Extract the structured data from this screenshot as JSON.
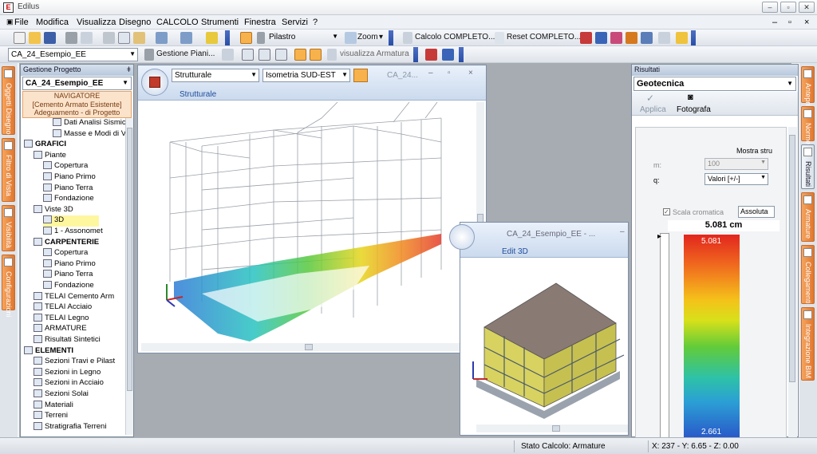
{
  "window": {
    "title": "Edilus",
    "min": "–",
    "max": "▫",
    "close": "✕"
  },
  "menu": [
    "File",
    "Modifica",
    "Visualizza",
    "Disegno",
    "CALCOLO",
    "Strumenti",
    "Finestra",
    "Servizi",
    "?"
  ],
  "toolbar1": {
    "element_combo": "Pilastro",
    "zoom_label": "Zoom",
    "calc_complete": "Calcolo COMPLETO...",
    "reset_complete": "Reset COMPLETO..."
  },
  "toolbar2": {
    "project_combo": "CA_24_Esempio_EE",
    "plans_label": "Gestione Piani...",
    "show_rebar": "visualizza Armatura"
  },
  "left_tabs": [
    "Oggetti Disegno",
    "Filtro di Vista",
    "Visibilità",
    "Configurazioni"
  ],
  "right_tabs": [
    "Anteprima",
    "Norme",
    "Risultati",
    "Armature",
    "Collegamenti",
    "Integrazione BIM"
  ],
  "project_panel": {
    "header": "Gestione Progetto",
    "pin": "ǂ",
    "combo": "CA_24_Esempio_EE",
    "navigator_title": "NAVIGATORE",
    "navigator_line1": "[Cemento Armato Esistente]",
    "navigator_line2": "Adeguamento - di Progetto",
    "tree": [
      {
        "label": "Dati Analisi Sismica",
        "indent": 4
      },
      {
        "label": "Masse e Modi di Vibr",
        "indent": 4
      },
      {
        "label": "GRAFICI",
        "indent": 1
      },
      {
        "label": "Piante",
        "indent": 2
      },
      {
        "label": "Copertura",
        "indent": 3
      },
      {
        "label": "Piano Primo",
        "indent": 3
      },
      {
        "label": "Piano Terra",
        "indent": 3
      },
      {
        "label": "Fondazione",
        "indent": 3
      },
      {
        "label": "Viste 3D",
        "indent": 2
      },
      {
        "label": "3D",
        "indent": 3
      },
      {
        "label": "1 - Assonomet",
        "indent": 3
      },
      {
        "label": "CARPENTERIE",
        "indent": 2
      },
      {
        "label": "Copertura",
        "indent": 3
      },
      {
        "label": "Piano Primo",
        "indent": 3
      },
      {
        "label": "Piano Terra",
        "indent": 3
      },
      {
        "label": "Fondazione",
        "indent": 3
      },
      {
        "label": "TELAI Cemento Arm",
        "indent": 2
      },
      {
        "label": "TELAI Acciaio",
        "indent": 2
      },
      {
        "label": "TELAI Legno",
        "indent": 2
      },
      {
        "label": "ARMATURE",
        "indent": 2
      },
      {
        "label": "Risultati Sintetici",
        "indent": 2
      },
      {
        "label": "ELEMENTI",
        "indent": 1
      },
      {
        "label": "Sezioni Travi e Pilast",
        "indent": 2
      },
      {
        "label": "Sezioni in Legno",
        "indent": 2
      },
      {
        "label": "Sezioni in Acciaio",
        "indent": 2
      },
      {
        "label": "Sezioni Solai",
        "indent": 2
      },
      {
        "label": "Materiali",
        "indent": 2
      },
      {
        "label": "Terreni",
        "indent": 2
      },
      {
        "label": "Stratigrafia Terreni",
        "indent": 2
      }
    ]
  },
  "structural_window": {
    "tab_title": "CA_24...",
    "view_combo": "Strutturale",
    "projection_combo": "Isometria SUD-EST",
    "ribbon_label": "Strutturale"
  },
  "view3d_window": {
    "title": "CA_24_Esempio_EE - ...",
    "ribbon_label": "Edit 3D"
  },
  "results_panel": {
    "header": "Risultati",
    "combo": "Geotecnica",
    "apply": "Applica",
    "photo": "Fotografa",
    "show_label": "Mostra stru",
    "m_label": "m:",
    "m_value": "100",
    "q_label": "q:",
    "q_value": "Valori  [+/-]",
    "scale_label": "Scala cromatica",
    "scale_mode": "Assoluta",
    "max_header": "5.081 cm",
    "max_value": "5.081",
    "min_value": "2.661"
  },
  "status": {
    "calc_state": "Stato Calcolo: Armature",
    "coords": "X: 237 - Y: 6.65 - Z: 0.00"
  },
  "colors": {
    "accent": "#2b56b0",
    "orange_tab": "#e9843a"
  }
}
